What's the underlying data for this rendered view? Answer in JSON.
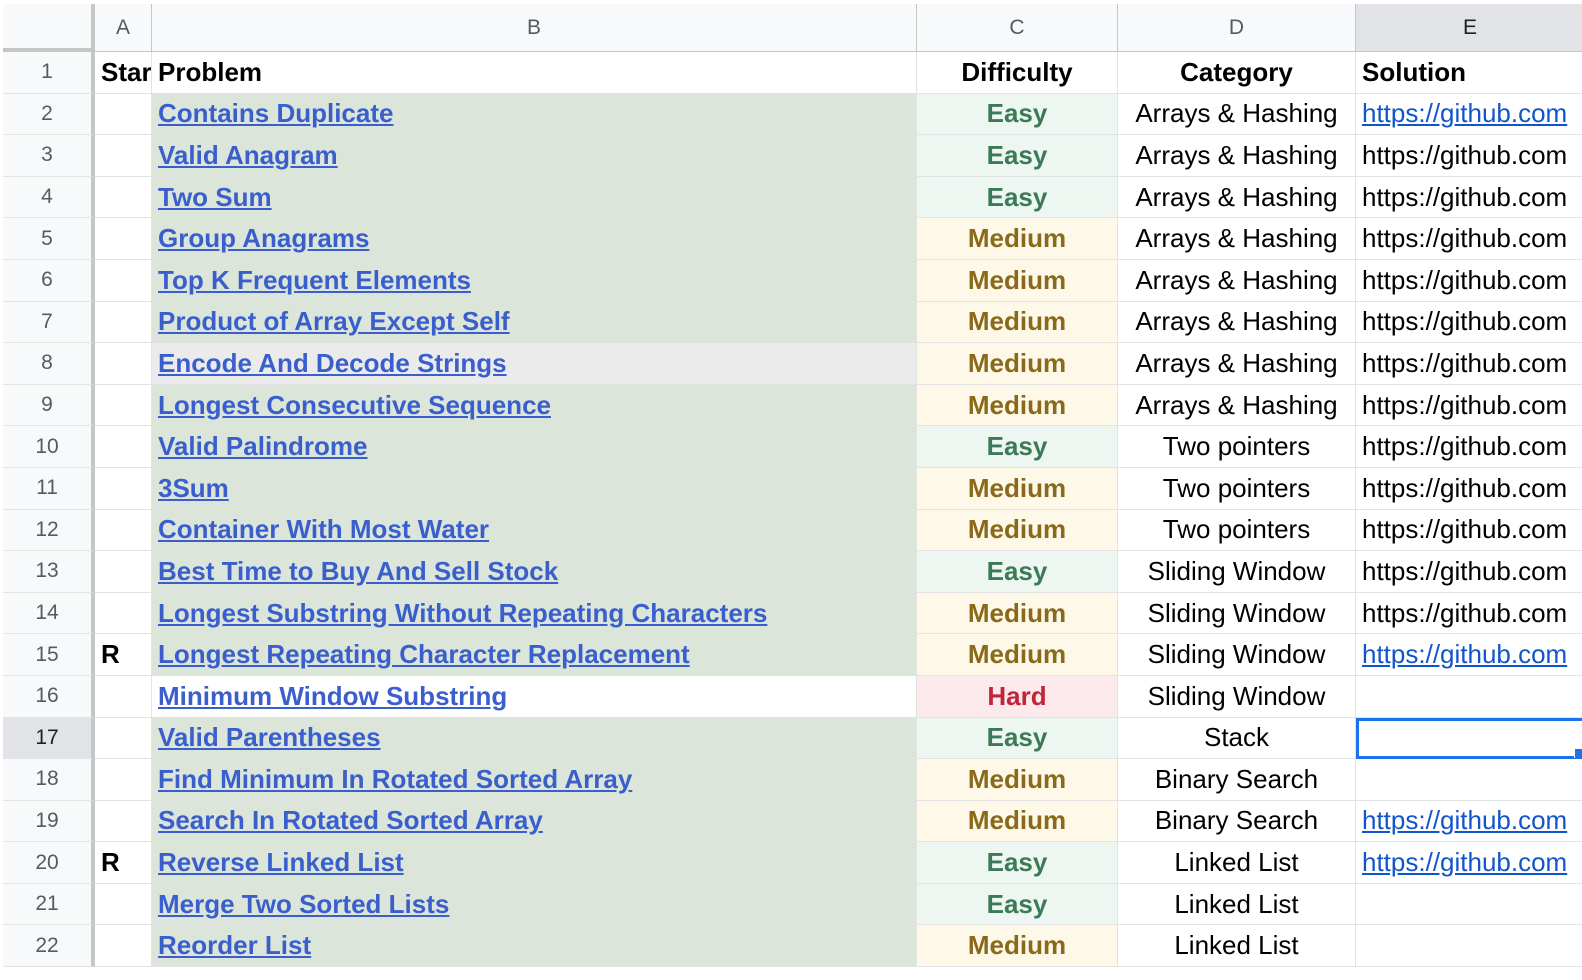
{
  "columns": [
    "A",
    "B",
    "C",
    "D",
    "E"
  ],
  "selected_column": "E",
  "selected_row": "17",
  "header_row": {
    "row_number": "1",
    "star": "Star",
    "problem": "Problem",
    "difficulty": "Difficulty",
    "category": "Category",
    "solution": "Solution"
  },
  "rows": [
    {
      "n": "2",
      "star": "",
      "problem": "Contains Duplicate",
      "difficulty": "Easy",
      "category": "Arrays & Hashing",
      "solution": "https://github.com",
      "sol_link": true
    },
    {
      "n": "3",
      "star": "",
      "problem": "Valid Anagram",
      "difficulty": "Easy",
      "category": "Arrays & Hashing",
      "solution": "https://github.com",
      "sol_link": false
    },
    {
      "n": "4",
      "star": "",
      "problem": "Two Sum",
      "difficulty": "Easy",
      "category": "Arrays & Hashing",
      "solution": "https://github.com",
      "sol_link": false
    },
    {
      "n": "5",
      "star": "",
      "problem": "Group Anagrams",
      "difficulty": "Medium",
      "category": "Arrays & Hashing",
      "solution": "https://github.com",
      "sol_link": false
    },
    {
      "n": "6",
      "star": "",
      "problem": "Top K Frequent Elements",
      "difficulty": "Medium",
      "category": "Arrays & Hashing",
      "solution": "https://github.com",
      "sol_link": false
    },
    {
      "n": "7",
      "star": "",
      "problem": "Product of Array Except Self",
      "difficulty": "Medium",
      "category": "Arrays & Hashing",
      "solution": "https://github.com",
      "sol_link": false
    },
    {
      "n": "8",
      "star": "",
      "problem": "Encode And Decode Strings",
      "difficulty": "Medium",
      "category": "Arrays & Hashing",
      "solution": "https://github.com",
      "sol_link": false,
      "bg": "grey"
    },
    {
      "n": "9",
      "star": "",
      "problem": "Longest Consecutive Sequence",
      "difficulty": "Medium",
      "category": "Arrays & Hashing",
      "solution": "https://github.com",
      "sol_link": false
    },
    {
      "n": "10",
      "star": "",
      "problem": "Valid Palindrome",
      "difficulty": "Easy",
      "category": "Two pointers",
      "solution": "https://github.com",
      "sol_link": false
    },
    {
      "n": "11",
      "star": "",
      "problem": "3Sum",
      "difficulty": "Medium",
      "category": "Two pointers",
      "solution": "https://github.com",
      "sol_link": false
    },
    {
      "n": "12",
      "star": "",
      "problem": "Container With Most Water",
      "difficulty": "Medium",
      "category": "Two pointers",
      "solution": "https://github.com",
      "sol_link": false
    },
    {
      "n": "13",
      "star": "",
      "problem": "Best Time to Buy And Sell Stock",
      "difficulty": "Easy",
      "category": "Sliding Window",
      "solution": "https://github.com",
      "sol_link": false
    },
    {
      "n": "14",
      "star": "",
      "problem": "Longest Substring Without Repeating Characters",
      "difficulty": "Medium",
      "category": "Sliding Window",
      "solution": "https://github.com",
      "sol_link": false
    },
    {
      "n": "15",
      "star": "R",
      "problem": "Longest Repeating Character Replacement",
      "difficulty": "Medium",
      "category": "Sliding Window",
      "solution": "https://github.com",
      "sol_link": true
    },
    {
      "n": "16",
      "star": "",
      "problem": "Minimum Window Substring",
      "difficulty": "Hard",
      "category": "Sliding Window",
      "solution": "",
      "sol_link": false,
      "bg": "white"
    },
    {
      "n": "17",
      "star": "",
      "problem": "Valid Parentheses",
      "difficulty": "Easy",
      "category": "Stack",
      "solution": "",
      "sol_link": false,
      "selected": true
    },
    {
      "n": "18",
      "star": "",
      "problem": "Find Minimum In Rotated Sorted Array",
      "difficulty": "Medium",
      "category": "Binary Search",
      "solution": "",
      "sol_link": false
    },
    {
      "n": "19",
      "star": "",
      "problem": "Search In Rotated Sorted Array",
      "difficulty": "Medium",
      "category": "Binary Search",
      "solution": "https://github.com",
      "sol_link": true
    },
    {
      "n": "20",
      "star": "R",
      "problem": "Reverse Linked List",
      "difficulty": "Easy",
      "category": "Linked List",
      "solution": "https://github.com",
      "sol_link": true
    },
    {
      "n": "21",
      "star": "",
      "problem": "Merge Two Sorted Lists",
      "difficulty": "Easy",
      "category": "Linked List",
      "solution": "",
      "sol_link": false
    },
    {
      "n": "22",
      "star": "",
      "problem": "Reorder List",
      "difficulty": "Medium",
      "category": "Linked List",
      "solution": "",
      "sol_link": false
    }
  ],
  "colors": {
    "link": "#3a5fcd",
    "easy": "#3b7a57",
    "medium": "#8a6a1a",
    "hard": "#c2253a",
    "selection": "#1a73e8",
    "problem_bg": "#dbe5da"
  }
}
